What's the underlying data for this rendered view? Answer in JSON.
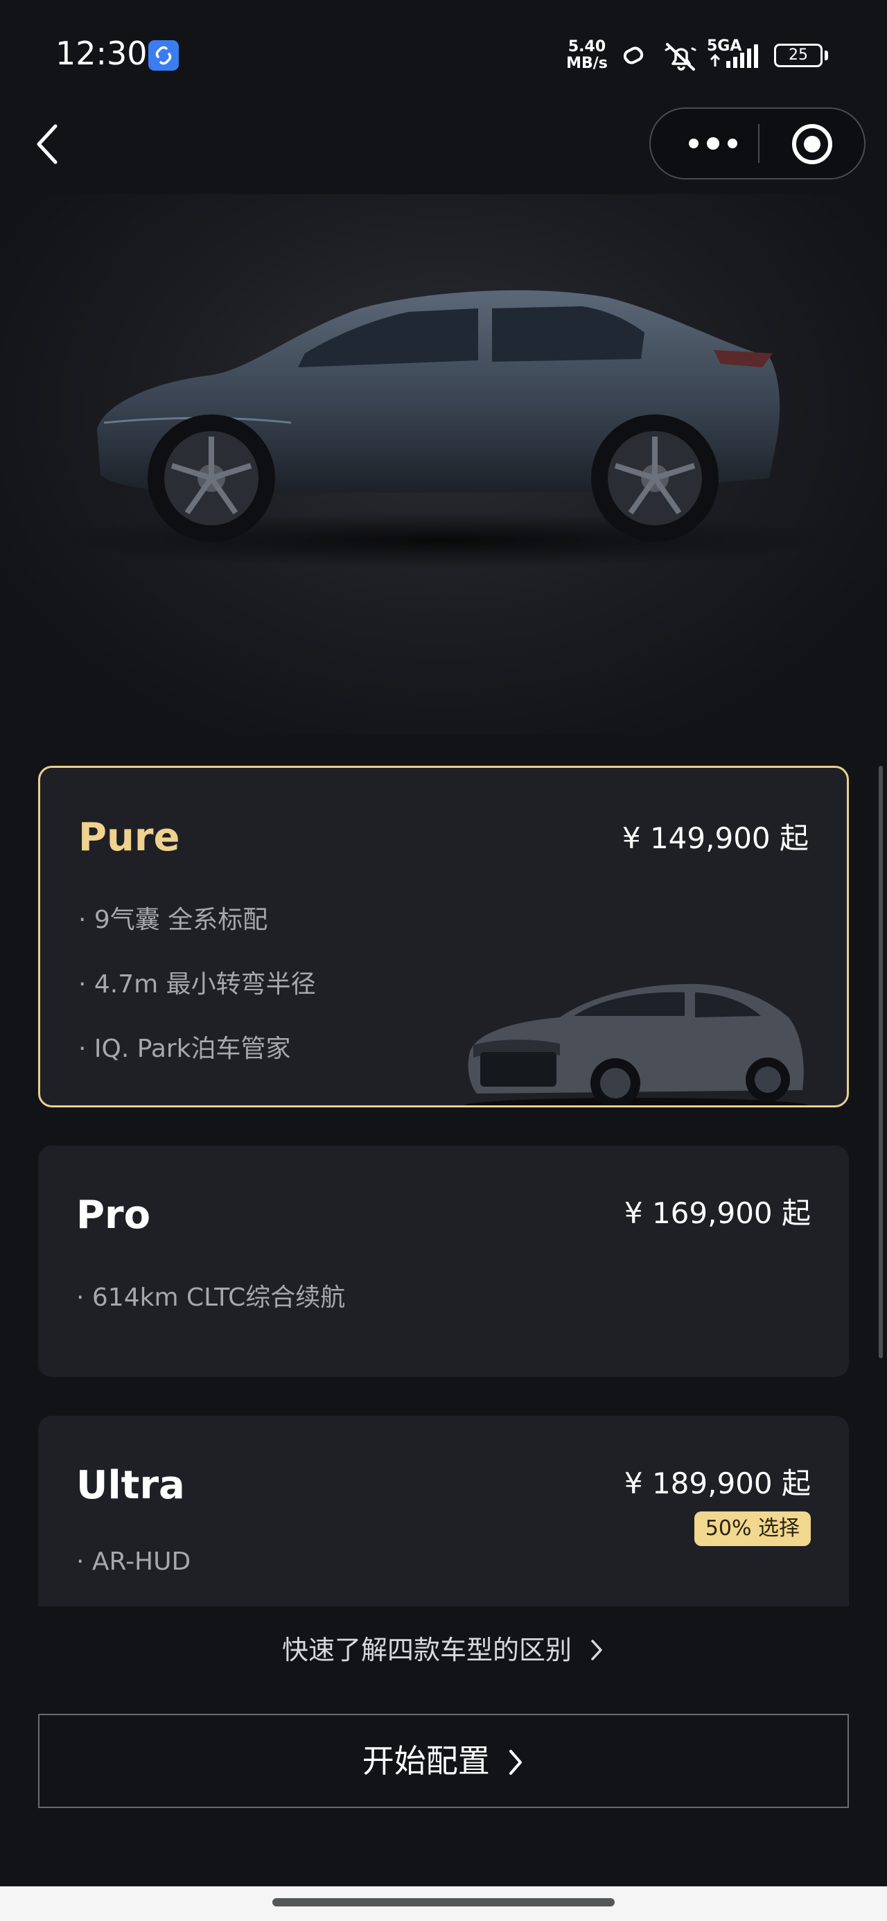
{
  "status_bar": {
    "time": "12:30",
    "net_speed_value": "5.40",
    "net_speed_unit": "MB/s",
    "signal_label": "5GA",
    "battery": "25"
  },
  "nav": {
    "back_icon": "chevron-left-icon",
    "more_icon": "more-dots-icon",
    "target_icon": "target-icon"
  },
  "trims": [
    {
      "name": "Pure",
      "price": "¥ 149,900 起",
      "features": [
        "· 9气囊 全系标配",
        "· 4.7m 最小转弯半径",
        "· IQ. Park泊车管家"
      ],
      "selected": true
    },
    {
      "name": "Pro",
      "price": "¥ 169,900 起",
      "features": [
        "· 614km CLTC综合续航"
      ],
      "selected": false
    },
    {
      "name": "Ultra",
      "price": "¥ 189,900 起",
      "badge": "50% 选择",
      "features": [
        "· AR-HUD"
      ],
      "selected": false
    }
  ],
  "compare_link": "快速了解四款车型的区别",
  "start_button": "开始配置",
  "colors": {
    "background": "#121317",
    "card": "#1f2026",
    "accent_gold": "#efd28e",
    "badge": "#f1d88e"
  }
}
